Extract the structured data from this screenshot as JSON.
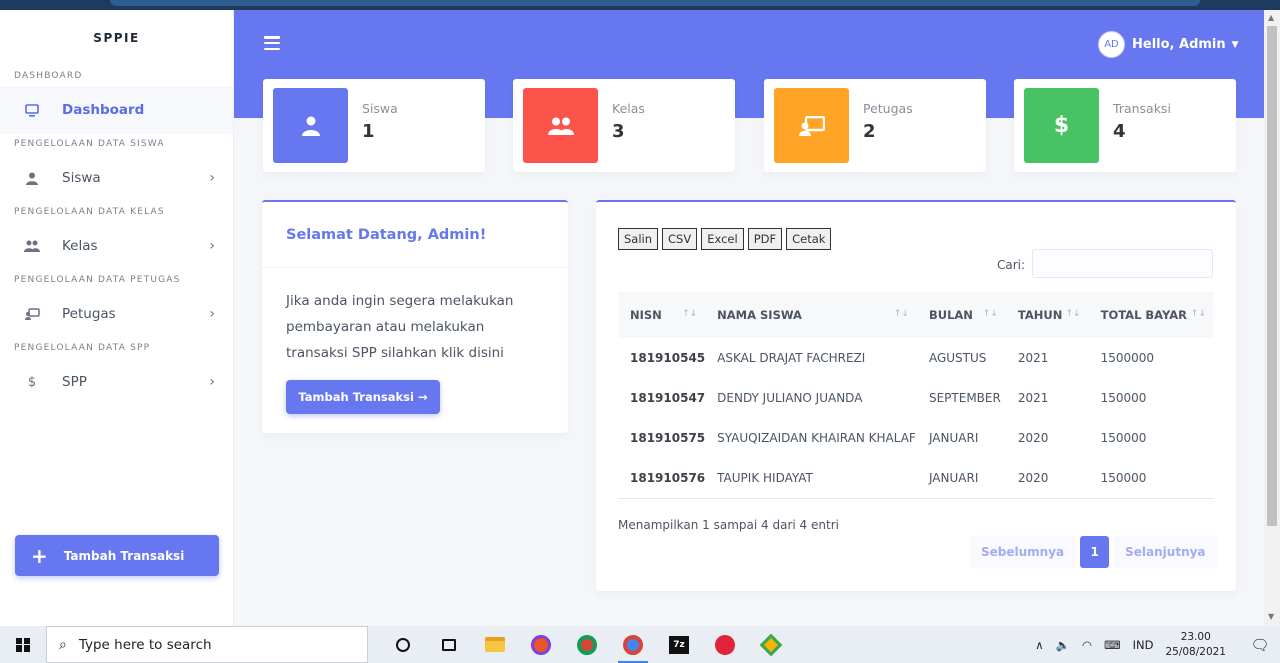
{
  "app": {
    "brand": "SPPIE"
  },
  "sidebar": {
    "sections": [
      {
        "heading": "DASHBOARD",
        "item": {
          "label": "Dashboard",
          "icon": "monitor-icon",
          "active": true,
          "has_chevron": false
        }
      },
      {
        "heading": "PENGELOLAAN DATA SISWA",
        "item": {
          "label": "Siswa",
          "icon": "user-icon",
          "active": false,
          "has_chevron": true
        }
      },
      {
        "heading": "PENGELOLAAN DATA KELAS",
        "item": {
          "label": "Kelas",
          "icon": "users-icon",
          "active": false,
          "has_chevron": true
        }
      },
      {
        "heading": "PENGELOLAAN DATA PETUGAS",
        "item": {
          "label": "Petugas",
          "icon": "chalkboard-teacher-icon",
          "active": false,
          "has_chevron": true
        }
      },
      {
        "heading": "PENGELOLAAN DATA SPP",
        "item": {
          "label": "SPP",
          "icon": "dollar-icon",
          "active": false,
          "has_chevron": true
        }
      }
    ],
    "cta_label": "Tambah Transaksi"
  },
  "header": {
    "avatar_initials": "AD",
    "greeting": "Hello, Admin"
  },
  "stats": [
    {
      "title": "Siswa",
      "value": "1",
      "color": "#6777ef",
      "icon": "user-icon"
    },
    {
      "title": "Kelas",
      "value": "3",
      "color": "#fc544b",
      "icon": "users-icon"
    },
    {
      "title": "Petugas",
      "value": "2",
      "color": "#ffa426",
      "icon": "chalkboard-teacher-icon"
    },
    {
      "title": "Transaksi",
      "value": "4",
      "color": "#47c363",
      "icon": "dollar-icon"
    }
  ],
  "welcome": {
    "title": "Selamat Datang, Admin!",
    "text": "Jika anda ingin segera melakukan pembayaran atau melakukan transaksi SPP silahkan klik disini",
    "button": "Tambah Transaksi →"
  },
  "table": {
    "export_buttons": [
      "Salin",
      "CSV",
      "Excel",
      "PDF",
      "Cetak"
    ],
    "search_label": "Cari:",
    "search_value": "",
    "columns": [
      "NISN",
      "NAMA SISWA",
      "BULAN",
      "TAHUN",
      "TOTAL BAYAR"
    ],
    "rows": [
      [
        "181910545",
        "ASKAL DRAJAT FACHREZI",
        "AGUSTUS",
        "2021",
        "1500000"
      ],
      [
        "181910547",
        "DENDY JULIANO JUANDA",
        "SEPTEMBER",
        "2021",
        "150000"
      ],
      [
        "181910575",
        "SYAUQIZAIDAN KHAIRAN KHALAF",
        "JANUARI",
        "2020",
        "150000"
      ],
      [
        "181910576",
        "TAUPIK HIDAYAT",
        "JANUARI",
        "2020",
        "150000"
      ]
    ],
    "info": "Menampilkan 1 sampai 4 dari 4 entri",
    "pagination": {
      "prev": "Sebelumnya",
      "current": "1",
      "next": "Selanjutnya"
    }
  },
  "taskbar": {
    "search_placeholder": "Type here to search",
    "tray_lang": "IND",
    "time": "23.00",
    "date": "25/08/2021"
  }
}
